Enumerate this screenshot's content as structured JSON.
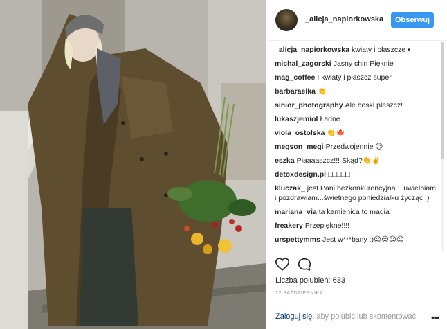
{
  "post": {
    "username": "_alicja_napiorkowska",
    "follow_label": "Obserwuj",
    "likes_label": "Liczba polubień:",
    "likes_count": "633",
    "date": "22 PAŹDZIERNIKA",
    "login_link": "Zaloguj się,",
    "login_text": " aby polubić lub skomentować.",
    "more_icon_glyph": "•••"
  },
  "comments": [
    {
      "author": "_alicja_napiorkowska",
      "text": "kwiaty i płaszcze •"
    },
    {
      "author": "michal_zagorski",
      "text": "Jasny chin Pięknie"
    },
    {
      "author": "mag_coffee",
      "text": "I kwiaty i płaszcz super"
    },
    {
      "author": "barbaraelka",
      "text": "👏"
    },
    {
      "author": "sinior_photography",
      "text": "Ale boski płaszcz!"
    },
    {
      "author": "lukaszjemiol",
      "text": "Ładne"
    },
    {
      "author": "viola_ostolska",
      "text": "👏🍁"
    },
    {
      "author": "megson_megi",
      "text": "Przedwojennie 😍"
    },
    {
      "author": "eszka",
      "text": "Płaaaaszcz!!! Skąd?👏✌️"
    },
    {
      "author": "detoxdesign.pl",
      "text": "□□□□□"
    },
    {
      "author": "kluczak_",
      "text": "jest Pani bezkonkurencyjna... uwielbiam i pozdrawiam...świetnego poniedziałku życząc :)"
    },
    {
      "author": "mariana_via",
      "text": "ta kamienica to magia"
    },
    {
      "author": "freakery",
      "text": "Przepiękne!!!!"
    },
    {
      "author": "urspettymms",
      "text": "Jest w***bany :)😍😍😍😍"
    }
  ],
  "icons": {
    "heart": "heart-outline-icon",
    "comment": "comment-bubble-icon"
  },
  "colors": {
    "follow_button": "#3897f0",
    "coat": "#5a4a2c",
    "link": "#003569"
  }
}
